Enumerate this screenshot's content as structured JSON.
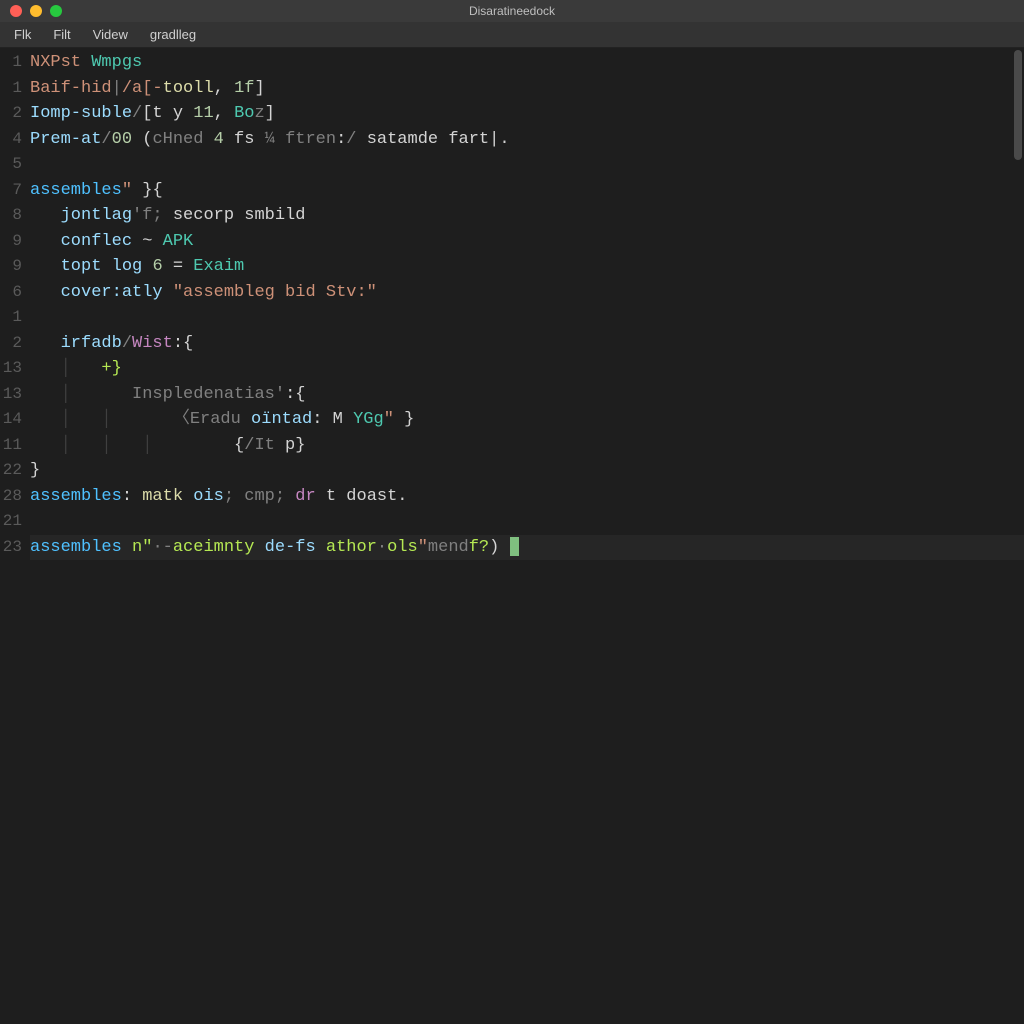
{
  "window": {
    "title": "Disaratineedock"
  },
  "menubar": {
    "items": [
      "Flk",
      "Filt",
      "Videw",
      "gradlleg"
    ]
  },
  "gutter": {
    "numbers": [
      "1",
      "1",
      "2",
      "4",
      "5",
      "7",
      "8",
      "9",
      "9",
      "6",
      "1",
      "2",
      "13",
      "13",
      "14",
      "11",
      "22",
      "28",
      "21",
      "23"
    ]
  },
  "code": {
    "lines": [
      {
        "t": "plain",
        "tokens": [
          {
            "c": "tok-warn",
            "v": "NXPst"
          },
          {
            "c": "",
            "v": " "
          },
          {
            "c": "tok-type",
            "v": "Wmpgs"
          }
        ]
      },
      {
        "t": "plain",
        "tokens": [
          {
            "c": "tok-warn",
            "v": "Baif-hid"
          },
          {
            "c": "tok-dim",
            "v": "|"
          },
          {
            "c": "tok-warn",
            "v": "/a[-"
          },
          {
            "c": "tok-id",
            "v": "tooll"
          },
          {
            "c": "",
            "v": ", "
          },
          {
            "c": "tok-num",
            "v": "1f"
          },
          {
            "c": "",
            "v": "]"
          }
        ]
      },
      {
        "t": "plain",
        "tokens": [
          {
            "c": "tok-prop",
            "v": "Iomp-suble"
          },
          {
            "c": "tok-dim",
            "v": "/"
          },
          {
            "c": "",
            "v": "[t y "
          },
          {
            "c": "tok-num",
            "v": "11"
          },
          {
            "c": "",
            "v": ", "
          },
          {
            "c": "tok-type",
            "v": "Bo"
          },
          {
            "c": "tok-dim",
            "v": "z"
          },
          {
            "c": "",
            "v": "]"
          }
        ]
      },
      {
        "t": "plain",
        "tokens": [
          {
            "c": "tok-prop",
            "v": "Prem-at"
          },
          {
            "c": "tok-dim",
            "v": "/"
          },
          {
            "c": "tok-num",
            "v": "00"
          },
          {
            "c": "",
            "v": " ("
          },
          {
            "c": "tok-dim",
            "v": "cHned"
          },
          {
            "c": "",
            "v": " "
          },
          {
            "c": "tok-num",
            "v": "4"
          },
          {
            "c": "",
            "v": " fs "
          },
          {
            "c": "tok-dim",
            "v": "¼"
          },
          {
            "c": "",
            "v": " "
          },
          {
            "c": "tok-dim",
            "v": "ftren"
          },
          {
            "c": "tok-op",
            "v": ":"
          },
          {
            "c": "tok-dim",
            "v": "/"
          },
          {
            "c": "",
            "v": " satamde fart|."
          }
        ]
      },
      {
        "t": "blank",
        "tokens": []
      },
      {
        "t": "plain",
        "tokens": [
          {
            "c": "tok-fn",
            "v": "assembles"
          },
          {
            "c": "tok-str",
            "v": "\""
          },
          {
            "c": "",
            "v": " }"
          },
          {
            "c": "tok-pun",
            "v": "{"
          }
        ]
      },
      {
        "t": "plain",
        "tokens": [
          {
            "c": "",
            "v": "   "
          },
          {
            "c": "tok-prop",
            "v": "jontlag"
          },
          {
            "c": "tok-dim",
            "v": "'f;"
          },
          {
            "c": "",
            "v": " secorp smbild"
          }
        ]
      },
      {
        "t": "plain",
        "tokens": [
          {
            "c": "",
            "v": "   "
          },
          {
            "c": "tok-prop",
            "v": "conflec"
          },
          {
            "c": "",
            "v": " ~ "
          },
          {
            "c": "tok-type",
            "v": "APK"
          }
        ]
      },
      {
        "t": "plain",
        "tokens": [
          {
            "c": "",
            "v": "   "
          },
          {
            "c": "tok-prop",
            "v": "topt log"
          },
          {
            "c": "",
            "v": " "
          },
          {
            "c": "tok-num",
            "v": "6"
          },
          {
            "c": "",
            "v": " = "
          },
          {
            "c": "tok-type",
            "v": "Exaim"
          }
        ]
      },
      {
        "t": "plain",
        "tokens": [
          {
            "c": "",
            "v": "   "
          },
          {
            "c": "tok-prop",
            "v": "cover:atly"
          },
          {
            "c": "",
            "v": " "
          },
          {
            "c": "tok-str",
            "v": "\"assembleg bid Stv:\""
          }
        ]
      },
      {
        "t": "blank",
        "tokens": []
      },
      {
        "t": "plain",
        "tokens": [
          {
            "c": "",
            "v": "   "
          },
          {
            "c": "tok-prop",
            "v": "irfadb"
          },
          {
            "c": "tok-dim",
            "v": "/"
          },
          {
            "c": "tok-kw",
            "v": "Wist"
          },
          {
            "c": "tok-op",
            "v": ":"
          },
          {
            "c": "tok-pun",
            "v": "{"
          }
        ]
      },
      {
        "t": "plain",
        "tokens": [
          {
            "c": "tok-indent",
            "v": "   │   "
          },
          {
            "c": "tok-lime",
            "v": "+}"
          }
        ]
      },
      {
        "t": "plain",
        "tokens": [
          {
            "c": "tok-indent",
            "v": "   │   "
          },
          {
            "c": "tok-dim",
            "v": "   Inspledenatias'"
          },
          {
            "c": "tok-op",
            "v": ":"
          },
          {
            "c": "tok-pun",
            "v": "{"
          }
        ]
      },
      {
        "t": "plain",
        "tokens": [
          {
            "c": "tok-indent",
            "v": "   │   │   "
          },
          {
            "c": "tok-dim",
            "v": "   〈Eradu "
          },
          {
            "c": "tok-prop",
            "v": "oïntad"
          },
          {
            "c": "tok-op",
            "v": ":"
          },
          {
            "c": "",
            "v": " M "
          },
          {
            "c": "tok-type",
            "v": "YGg"
          },
          {
            "c": "tok-str",
            "v": "\""
          },
          {
            "c": "",
            "v": " "
          },
          {
            "c": "tok-pun",
            "v": "}"
          }
        ]
      },
      {
        "t": "plain",
        "tokens": [
          {
            "c": "tok-indent",
            "v": "   │   │   │   "
          },
          {
            "c": "",
            "v": "     "
          },
          {
            "c": "tok-pun",
            "v": "{"
          },
          {
            "c": "tok-dim",
            "v": "/It"
          },
          {
            "c": "",
            "v": " p"
          },
          {
            "c": "tok-pun",
            "v": "}"
          }
        ]
      },
      {
        "t": "plain",
        "tokens": [
          {
            "c": "tok-pun",
            "v": "}"
          }
        ]
      },
      {
        "t": "plain",
        "tokens": [
          {
            "c": "tok-fn",
            "v": "assembles"
          },
          {
            "c": "tok-op",
            "v": ":"
          },
          {
            "c": "",
            "v": " "
          },
          {
            "c": "tok-id",
            "v": "matk"
          },
          {
            "c": "",
            "v": " "
          },
          {
            "c": "tok-prop",
            "v": "ois"
          },
          {
            "c": "tok-dim",
            "v": "; cmp;"
          },
          {
            "c": "",
            "v": " "
          },
          {
            "c": "tok-kw",
            "v": "dr"
          },
          {
            "c": "",
            "v": " t doast."
          }
        ]
      },
      {
        "t": "blank",
        "tokens": []
      },
      {
        "t": "hl",
        "tokens": [
          {
            "c": "tok-fn",
            "v": "assembles"
          },
          {
            "c": "",
            "v": " "
          },
          {
            "c": "tok-lime",
            "v": "n\""
          },
          {
            "c": "tok-dim",
            "v": "·-"
          },
          {
            "c": "tok-lime",
            "v": "aceimnty"
          },
          {
            "c": "",
            "v": " "
          },
          {
            "c": "tok-prop",
            "v": "de-fs"
          },
          {
            "c": "",
            "v": " "
          },
          {
            "c": "tok-lime",
            "v": "athor"
          },
          {
            "c": "tok-dim",
            "v": "·"
          },
          {
            "c": "tok-lime",
            "v": "ols"
          },
          {
            "c": "tok-str",
            "v": "\""
          },
          {
            "c": "tok-dim",
            "v": "mend"
          },
          {
            "c": "tok-lime",
            "v": "f?"
          },
          {
            "c": "",
            "v": ") "
          }
        ],
        "cursor": true
      }
    ]
  }
}
